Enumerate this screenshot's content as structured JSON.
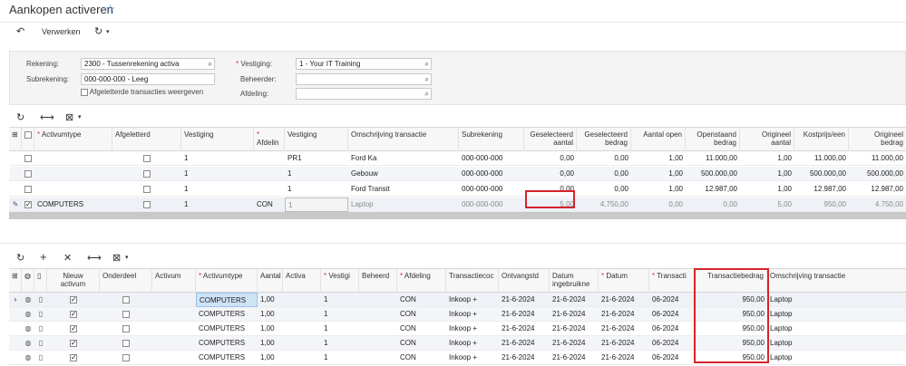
{
  "title": "Aankopen activeren",
  "toolbar": {
    "undo_icon": "undo-icon",
    "process_label": "Verwerken",
    "refresh_icon": "refresh-icon"
  },
  "filter": {
    "account_label": "Rekening:",
    "account_value": "2300 - Tussenrekening activa",
    "subaccount_label": "Subrekening:",
    "subaccount_value": "000-000-000 - Leeg",
    "show_reconciled_label": "Afgeletterde transacties weergeven",
    "branch_label": "Vestiging:",
    "branch_value": "1 - Your IT Training",
    "manager_label": "Beheerder:",
    "manager_value": "",
    "department_label": "Afdeling:",
    "department_value": ""
  },
  "top_grid": {
    "headers": {
      "asset_type": "Activumtype",
      "reconciled": "Afgeletterd",
      "branch": "Vestiging",
      "department": "Afdelin",
      "branch2": "Vestiging",
      "description": "Omschrijving transactie",
      "subaccount": "Subrekening",
      "sel_qty": "Geselecteerd aantal",
      "sel_amount": "Geselecteerd bedrag",
      "open_qty": "Aantal open",
      "open_amount": "Openstaand bedrag",
      "orig_qty": "Origineel aantal",
      "unit_cost": "Kostprijs/een",
      "orig_amount": "Origineel bedrag"
    },
    "rows": [
      {
        "selected": false,
        "asset_type": "",
        "branch": "1",
        "dept": "",
        "branch2": "PR1",
        "description": "Ford Ka",
        "subaccount": "000-000-000",
        "sel_qty": "0,00",
        "sel_amount": "0,00",
        "open_qty": "1,00",
        "open_amount": "11.000,00",
        "orig_qty": "1,00",
        "unit_cost": "11.000,00",
        "orig_amount": "11.000,00"
      },
      {
        "selected": false,
        "asset_type": "",
        "branch": "1",
        "dept": "",
        "branch2": "1",
        "description": "Gebouw",
        "subaccount": "000-000-000",
        "sel_qty": "0,00",
        "sel_amount": "0,00",
        "open_qty": "1,00",
        "open_amount": "500.000,00",
        "orig_qty": "1,00",
        "unit_cost": "500.000,00",
        "orig_amount": "500.000,00"
      },
      {
        "selected": false,
        "asset_type": "",
        "branch": "1",
        "dept": "",
        "branch2": "1",
        "description": "Ford Transit",
        "subaccount": "000-000-000",
        "sel_qty": "0,00",
        "sel_amount": "0,00",
        "open_qty": "1,00",
        "open_amount": "12.987,00",
        "orig_qty": "1,00",
        "unit_cost": "12.987,00",
        "orig_amount": "12.987,00"
      },
      {
        "selected": true,
        "asset_type": "COMPUTERS",
        "branch": "1",
        "dept": "CON",
        "branch2": "1",
        "description": "Laptop",
        "subaccount": "000-000-000",
        "sel_qty": "5,00",
        "sel_amount": "4.750,00",
        "open_qty": "0,00",
        "open_amount": "0,00",
        "orig_qty": "5,00",
        "unit_cost": "950,00",
        "orig_amount": "4.750,00"
      }
    ]
  },
  "bottom_grid": {
    "headers": {
      "new_asset": "Nieuw activum",
      "component": "Onderdeel",
      "asset": "Activum",
      "asset_type": "Activumtype",
      "qty": "Aantal",
      "active": "Activa",
      "branch": "Vestigi",
      "manager": "Beheerd",
      "department": "Afdeling",
      "trans_code": "Transactiecoc",
      "receipt_date": "Ontvangstd",
      "in_use_date": "Datum ingebruikne",
      "date": "Datum",
      "trans_period": "Transacti",
      "trans_amount": "Transactiebedrag",
      "description": "Omschrijving transactie"
    },
    "rows": [
      {
        "asset_type": "COMPUTERS",
        "qty": "1,00",
        "branch": "1",
        "dept": "CON",
        "trans_code": "Inkoop +",
        "receipt": "21-6-2024",
        "in_use": "21-6-2024",
        "date": "21-6-2024",
        "period": "06-2024",
        "amount": "950,00",
        "description": "Laptop"
      },
      {
        "asset_type": "COMPUTERS",
        "qty": "1,00",
        "branch": "1",
        "dept": "CON",
        "trans_code": "Inkoop +",
        "receipt": "21-6-2024",
        "in_use": "21-6-2024",
        "date": "21-6-2024",
        "period": "06-2024",
        "amount": "950,00",
        "description": "Laptop"
      },
      {
        "asset_type": "COMPUTERS",
        "qty": "1,00",
        "branch": "1",
        "dept": "CON",
        "trans_code": "Inkoop +",
        "receipt": "21-6-2024",
        "in_use": "21-6-2024",
        "date": "21-6-2024",
        "period": "06-2024",
        "amount": "950,00",
        "description": "Laptop"
      },
      {
        "asset_type": "COMPUTERS",
        "qty": "1,00",
        "branch": "1",
        "dept": "CON",
        "trans_code": "Inkoop +",
        "receipt": "21-6-2024",
        "in_use": "21-6-2024",
        "date": "21-6-2024",
        "period": "06-2024",
        "amount": "950,00",
        "description": "Laptop"
      },
      {
        "asset_type": "COMPUTERS",
        "qty": "1,00",
        "branch": "1",
        "dept": "CON",
        "trans_code": "Inkoop +",
        "receipt": "21-6-2024",
        "in_use": "21-6-2024",
        "date": "21-6-2024",
        "period": "06-2024",
        "amount": "950,00",
        "description": "Laptop"
      }
    ]
  },
  "colors": {
    "highlight": "#d6242a",
    "accent": "#4a8ed8",
    "selected_cell": "#cfe3f7"
  }
}
